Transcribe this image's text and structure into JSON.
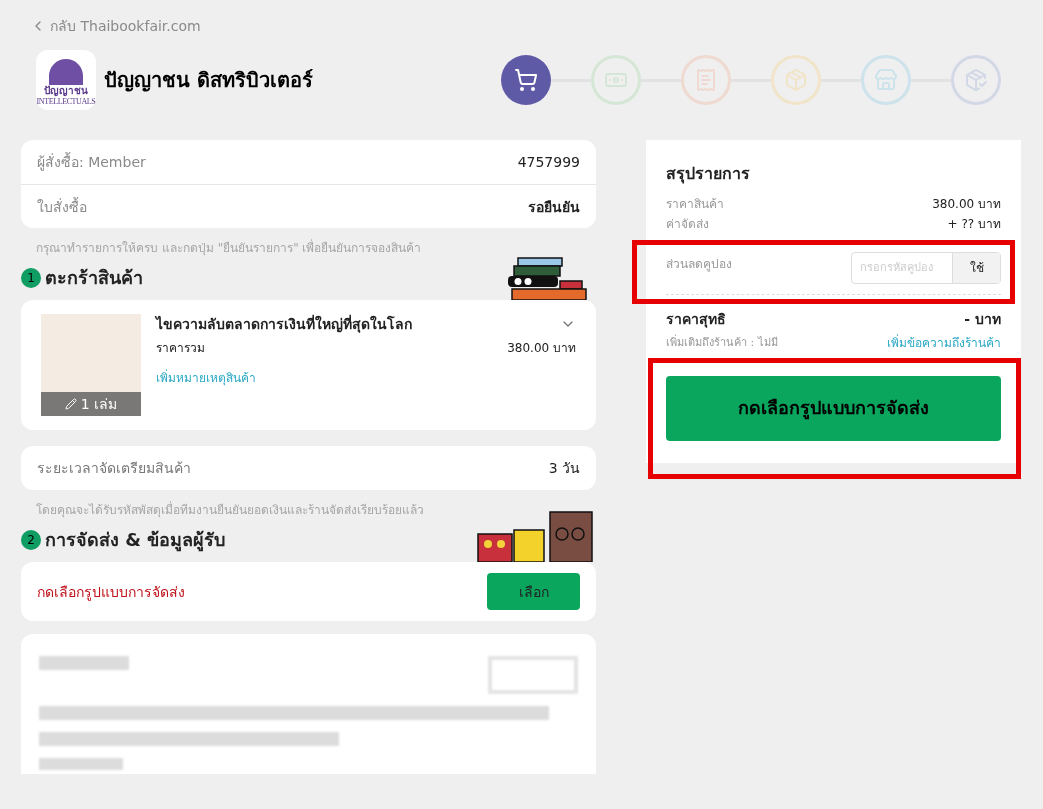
{
  "back_link": {
    "label": "กลับ Thaibookfair.com"
  },
  "shop": {
    "name": "ปัญญาชน ดิสทริบิวเตอร์",
    "logo_text": "ปัญญาชน",
    "logo_subtext": "INTELLECTUALS"
  },
  "steps": [
    {
      "kind": "cart",
      "selected": true,
      "color": "#5f5aa6"
    },
    {
      "kind": "payment",
      "selected": false,
      "color": "#d6e6d6"
    },
    {
      "kind": "receipt",
      "selected": false,
      "color": "#efd9d0"
    },
    {
      "kind": "packing",
      "selected": false,
      "color": "#f1e4c9"
    },
    {
      "kind": "store",
      "selected": false,
      "color": "#cde3ec"
    },
    {
      "kind": "delivered",
      "selected": false,
      "color": "#d2d8e6"
    }
  ],
  "order_info": [
    {
      "label": "ผู้สั่งซื้อ: Member",
      "value": "4757999",
      "bold": false
    },
    {
      "label": "ใบสั่งซื้อ",
      "value": "รอยืนยัน",
      "bold": true
    }
  ],
  "order_note": "กรุณาทำรายการให้ครบ และกดปุ่ม \"ยืนยันรายการ\" เพื่อยืนยันการจองสินค้า",
  "cart_section": {
    "number": "1",
    "title": "ตะกร้าสินค้า"
  },
  "cart_items": [
    {
      "title": "ไขความลับตลาดการเงินที่ใหญ่ที่สุดในโลก",
      "price_label": "ราคารวม",
      "price": "380.00 บาท",
      "note_link": "เพิ่มหมายเหตุสินค้า",
      "quantity": "1 เล่ม"
    }
  ],
  "preparation": {
    "label": "ระยะเวลาจัดเตรียมสินค้า",
    "value": "3 วัน"
  },
  "preparation_note": "โดยคุณจะได้รับรหัสพัสดุเมื่อทีมงานยืนยันยอดเงินและร้านจัดส่งเรียบร้อยแล้ว",
  "shipping_section": {
    "number": "2",
    "title": "การจัดส่ง & ข้อมูลผู้รับ"
  },
  "shipping": {
    "prompt": "กดเลือกรูปแบบการจัดส่ง",
    "button": "เลือก"
  },
  "summary": {
    "title": "สรุปรายการ",
    "lines": [
      {
        "label": "ราคาสินค้า",
        "value": "380.00 บาท"
      },
      {
        "label": "ค่าจัดส่ง",
        "value": "+ ?? บาท"
      }
    ],
    "coupon": {
      "label": "ส่วนลดคูปอง",
      "placeholder": "กรอกรหัสคูปอง",
      "button": "ใช้"
    },
    "net": {
      "label": "ราคาสุทธิ",
      "value": "- บาท"
    },
    "extra": {
      "label": "เพิ่มเติมถึงร้านค้า : ไม่มี",
      "link": "เพิ่มข้อความถึงร้านค้า"
    },
    "submit": "กดเลือกรูปแบบการจัดส่ง"
  }
}
